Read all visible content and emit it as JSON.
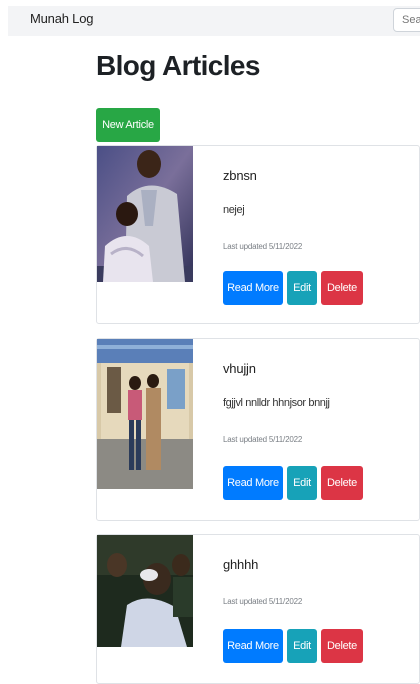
{
  "navbar": {
    "brand": "Munah Log",
    "search_placeholder": "Search"
  },
  "page": {
    "title": "Blog Articles",
    "new_article_label": "New Article"
  },
  "articles": [
    {
      "title": "zbnsn",
      "body": "nejej",
      "updated": "Last updated 5/11/2022",
      "read_label": "Read More",
      "edit_label": "Edit",
      "delete_label": "Delete"
    },
    {
      "title": "vhujjn",
      "body": "fgjjvl nnlldr hhnjsor bnnjj",
      "updated": "Last updated 5/11/2022",
      "read_label": "Read More",
      "edit_label": "Edit",
      "delete_label": "Delete"
    },
    {
      "title": "ghhhh",
      "body": "",
      "updated": "Last updated 5/11/2022",
      "read_label": "Read More",
      "edit_label": "Edit",
      "delete_label": "Delete"
    }
  ],
  "colors": {
    "success": "#28a745",
    "primary": "#007bff",
    "info": "#17a2b8",
    "danger": "#dc3545"
  }
}
